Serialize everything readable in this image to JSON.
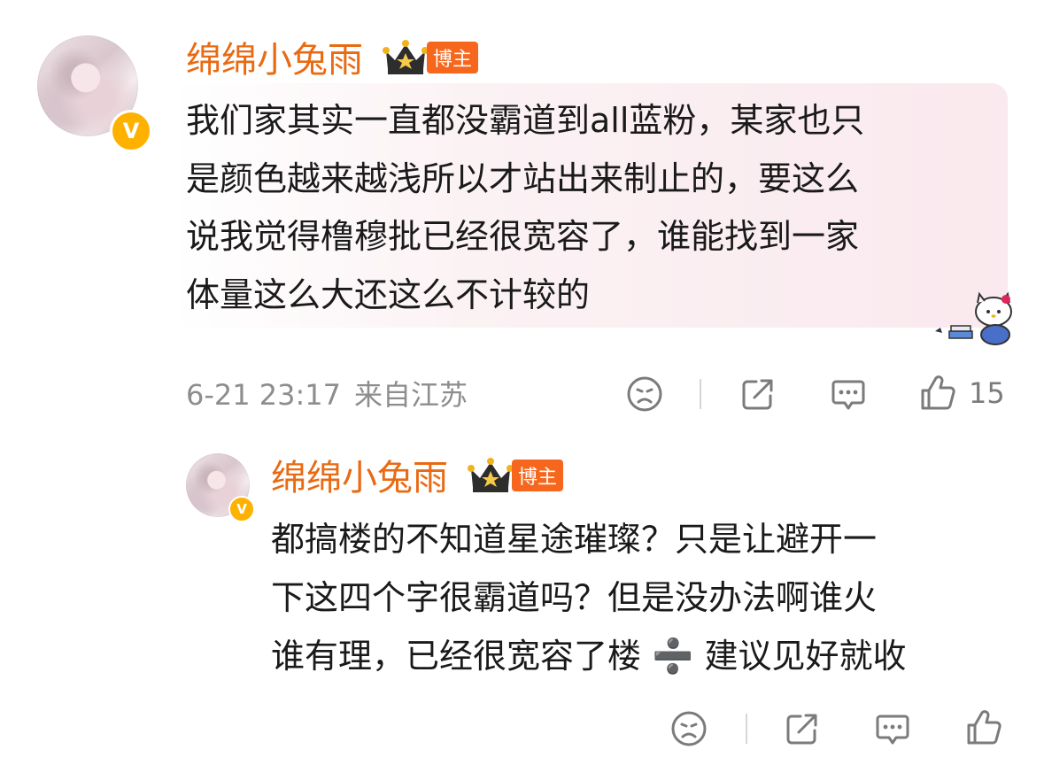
{
  "comment": {
    "username": "绵绵小兔雨",
    "role_badge": "博主",
    "crown_level": "II",
    "text": "我们家其实一直都没霸道到all蓝粉，某家也只\n是颜色越来越浅所以才站出来制止的，要这么\n说我觉得橹穆批已经很宽容了，谁能找到一家\n体量这么大还这么不计较的",
    "datetime": "6-21 23:17",
    "location": "来自江苏",
    "likes": "15",
    "icons": {
      "dislike": "frown-face-icon",
      "share": "share-icon",
      "reply": "comment-icon",
      "like": "thumbs-up-icon"
    }
  },
  "reply": {
    "username": "绵绵小兔雨",
    "role_badge": "博主",
    "crown_level": "II",
    "text": "都搞楼的不知道星途璀璨？只是让避开一\n下这四个字很霸道吗？但是没办法啊谁火\n谁有理，已经很宽容了楼 ➗ 建议见好就收"
  },
  "colors": {
    "username": "#e96a12",
    "badge": "#f6661c",
    "verified": "#ffb100",
    "meta": "#8d8d8d"
  }
}
